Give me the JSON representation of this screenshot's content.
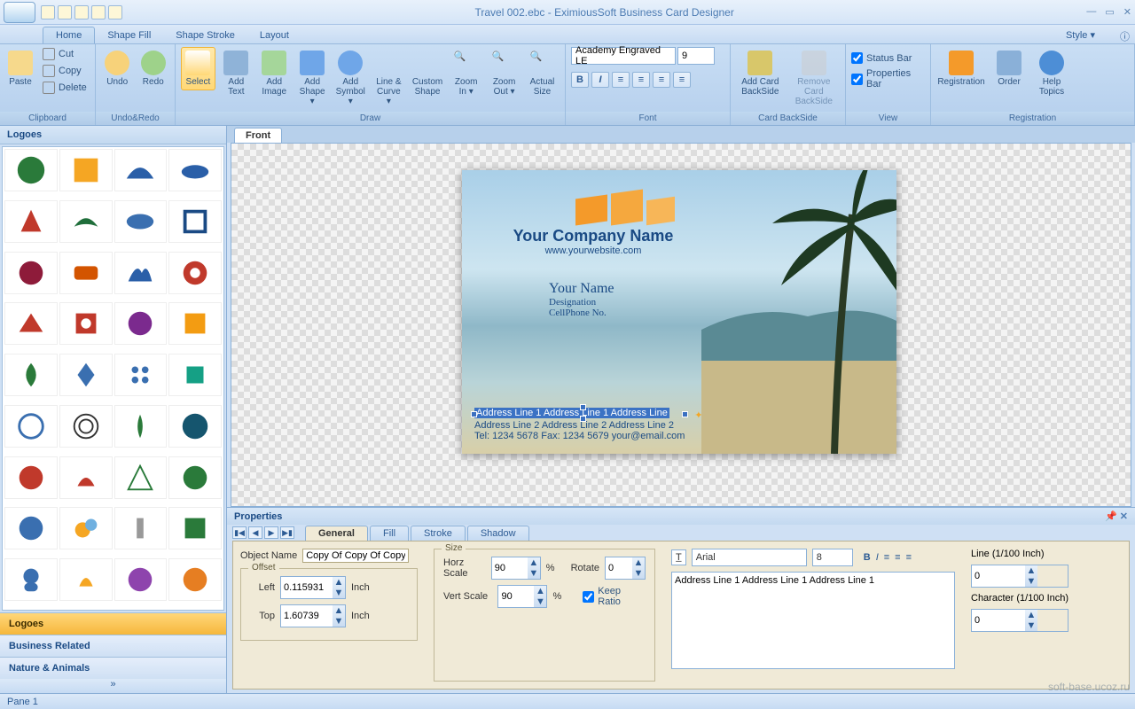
{
  "title": "Travel 002.ebc - EximiousSoft Business Card Designer",
  "qat_icons": [
    "new-icon",
    "open-icon",
    "save-icon",
    "print-icon",
    "quickprint-icon"
  ],
  "tabs": {
    "home": "Home",
    "shape_fill": "Shape Fill",
    "shape_stroke": "Shape Stroke",
    "layout": "Layout",
    "style": "Style ▾"
  },
  "ribbon": {
    "clipboard": {
      "paste": "Paste",
      "cut": "Cut",
      "copy": "Copy",
      "delete": "Delete",
      "label": "Clipboard"
    },
    "undoredo": {
      "undo": "Undo",
      "redo": "Redo",
      "label": "Undo&Redo"
    },
    "draw": {
      "select": "Select",
      "add_text": "Add\nText",
      "add_image": "Add\nImage",
      "add_shape": "Add\nShape ▾",
      "add_symbol": "Add\nSymbol ▾",
      "line_curve": "Line &\nCurve ▾",
      "custom_shape": "Custom\nShape",
      "zoom_in": "Zoom\nIn ▾",
      "zoom_out": "Zoom\nOut ▾",
      "actual_size": "Actual\nSize",
      "label": "Draw"
    },
    "font": {
      "name": "Academy Engraved LE",
      "size": "9",
      "label": "Font"
    },
    "backside": {
      "add": "Add Card\nBackSide",
      "remove": "Remove Card\nBackSide",
      "label": "Card BackSide"
    },
    "view": {
      "status": "Status Bar",
      "props": "Properties Bar",
      "label": "View"
    },
    "reg": {
      "registration": "Registration",
      "order": "Order",
      "help": "Help\nTopics",
      "label": "Registration"
    }
  },
  "sidebar": {
    "title": "Logoes",
    "cats": [
      "Logoes",
      "Business Related",
      "Nature & Animals"
    ]
  },
  "canvas": {
    "tab": "Front",
    "company": "Your Company Name",
    "website": "www.yourwebsite.com",
    "name": "Your Name",
    "designation": "Designation",
    "cell": "CellPhone No.",
    "addr1": "Address Line 1 Address Line 1 Address Line",
    "addr2": "Address Line 2 Address Line 2 Address Line 2",
    "tel": "Tel: 1234 5678   Fax: 1234 5679  your@email.com"
  },
  "props": {
    "title": "Properties",
    "tabs": [
      "General",
      "Fill",
      "Stroke",
      "Shadow"
    ],
    "object_name_label": "Object Name",
    "object_name": "Copy Of Copy Of Copy (",
    "offset": "Offset",
    "left_label": "Left",
    "left": "0.115931",
    "top_label": "Top",
    "top": "1.60739",
    "inch": "Inch",
    "size": "Size",
    "horz_label": "Horz Scale",
    "horz": "90",
    "vert_label": "Vert Scale",
    "vert": "90",
    "pct": "%",
    "rotate_label": "Rotate",
    "rotate": "0",
    "keep": "Keep Ratio",
    "font": "Arial",
    "font_size": "8",
    "text": "Address Line 1 Address Line 1 Address Line 1",
    "line_label": "Line (1/100 Inch)",
    "line": "0",
    "char_label": "Character (1/100 Inch)",
    "char": "0"
  },
  "status": {
    "pane": "Pane 1",
    "watermark": "soft-base.ucoz.ru"
  }
}
